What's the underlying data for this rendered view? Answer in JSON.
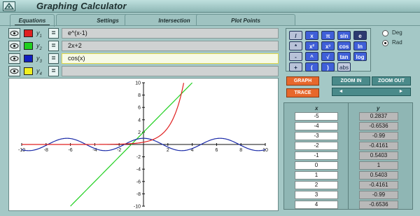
{
  "title": "Graphing Calculator",
  "tabs": [
    {
      "label": "Equations",
      "active": true
    },
    {
      "label": "Settings",
      "active": false
    },
    {
      "label": "Intersection",
      "active": false
    },
    {
      "label": "Plot Points",
      "active": false
    }
  ],
  "equations": [
    {
      "label": "y",
      "sub": "1",
      "color": "#e02020",
      "expr": "e^(x-1)"
    },
    {
      "label": "y",
      "sub": "2",
      "color": "#20d020",
      "expr": "2x+2"
    },
    {
      "label": "y",
      "sub": "3",
      "color": "#1020c0",
      "expr": "cos(x)"
    },
    {
      "label": "y",
      "sub": "4",
      "color": "#f0f020",
      "expr": ""
    }
  ],
  "eq_button": "=",
  "keypad": [
    [
      "/",
      "x",
      "π",
      "sin",
      "e"
    ],
    [
      "*",
      "x²",
      "x³",
      "cos",
      "ln"
    ],
    [
      "-",
      "^",
      "√",
      "tan",
      "log"
    ],
    [
      "+",
      "(",
      ")",
      "abs"
    ]
  ],
  "angle_mode": {
    "deg": "Deg",
    "rad": "Rad",
    "selected": "Rad"
  },
  "buttons": {
    "graph": "GRAPH",
    "trace": "TRACE",
    "zoom_in": "ZOOM IN",
    "zoom_out": "ZOOM OUT",
    "scroll_left": "◄",
    "scroll_right": "►"
  },
  "graph": {
    "xlim": [
      -10,
      10
    ],
    "ylim": [
      -10,
      10
    ],
    "x_ticks": [
      -10,
      -8,
      -6,
      -4,
      -2,
      2,
      4,
      6,
      8,
      10
    ],
    "y_ticks": [
      10,
      8,
      6,
      4,
      2,
      -2,
      -4,
      -6,
      -8,
      -10
    ]
  },
  "table": {
    "x_header": "x",
    "y_header": "y",
    "rows": [
      {
        "x": "-5",
        "y": "0.2837"
      },
      {
        "x": "-4",
        "y": "-0.6536"
      },
      {
        "x": "-3",
        "y": "-0.99"
      },
      {
        "x": "-2",
        "y": "-0.4161"
      },
      {
        "x": "-1",
        "y": "0.5403"
      },
      {
        "x": "0",
        "y": "1"
      },
      {
        "x": "1",
        "y": "0.5403"
      },
      {
        "x": "2",
        "y": "-0.4161"
      },
      {
        "x": "3",
        "y": "-0.99"
      },
      {
        "x": "4",
        "y": "-0.6536"
      }
    ]
  }
}
